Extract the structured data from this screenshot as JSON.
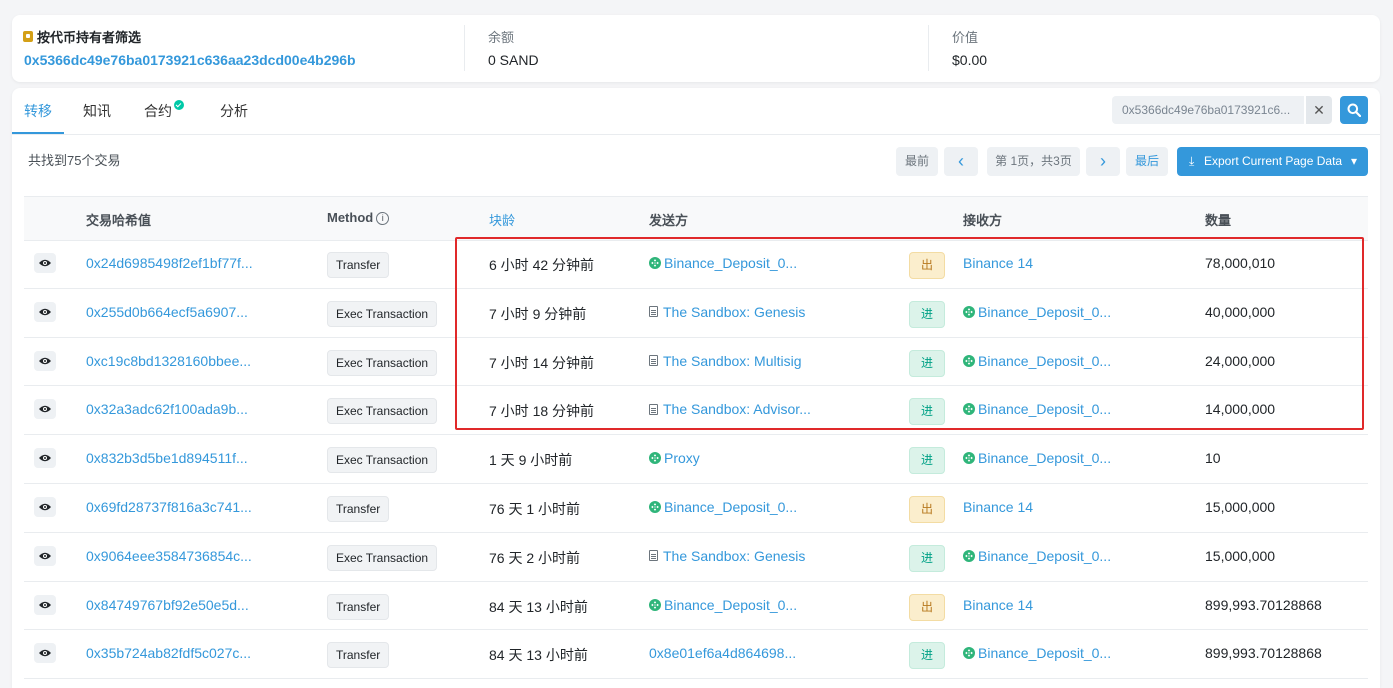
{
  "top": {
    "filter_label": "按代币持有者筛选",
    "address": "0x5366dc49e76ba0173921c636aa23dcd00e4b296b",
    "balance_label": "余额",
    "balance_value": "0 SAND",
    "value_label": "价值",
    "value_value": "$0.00"
  },
  "tabs": [
    "转移",
    "知讯",
    "合约",
    "分析"
  ],
  "filter": {
    "value": "0x5366dc49e76ba0173921c6..."
  },
  "found_text": "共找到75个交易",
  "pagination": {
    "first": "最前",
    "prev": "‹",
    "info": "第 1页，共3页",
    "next": "›",
    "last": "最后"
  },
  "export_label": "Export Current Page Data",
  "table": {
    "headers": {
      "hash": "交易哈希值",
      "method": "Method",
      "age": "块龄",
      "from": "发送方",
      "to": "接收方",
      "quantity": "数量"
    },
    "rows": [
      {
        "hash": "0x24d6985498f2ef1bf77f...",
        "method": "Transfer",
        "age": "6 小时 42 分钟前",
        "from": "Binance_Deposit_0...",
        "from_icon": "binance-icon",
        "dir": "出",
        "to": "Binance 14",
        "to_icon": "",
        "qty": "78,000,010"
      },
      {
        "hash": "0x255d0b664ecf5a6907...",
        "method": "Exec Transaction",
        "age": "7 小时 9 分钟前",
        "from": "The Sandbox: Genesis",
        "from_icon": "contract-icon",
        "dir": "进",
        "to": "Binance_Deposit_0...",
        "to_icon": "binance-icon",
        "qty": "40,000,000"
      },
      {
        "hash": "0xc19c8bd1328160bbee...",
        "method": "Exec Transaction",
        "age": "7 小时 14 分钟前",
        "from": "The Sandbox: Multisig",
        "from_icon": "contract-icon",
        "dir": "进",
        "to": "Binance_Deposit_0...",
        "to_icon": "binance-icon",
        "qty": "24,000,000"
      },
      {
        "hash": "0x32a3adc62f100ada9b...",
        "method": "Exec Transaction",
        "age": "7 小时 18 分钟前",
        "from": "The Sandbox: Advisor...",
        "from_icon": "contract-icon",
        "dir": "进",
        "to": "Binance_Deposit_0...",
        "to_icon": "binance-icon",
        "qty": "14,000,000"
      },
      {
        "hash": "0x832b3d5be1d894511f...",
        "method": "Exec Transaction",
        "age": "1 天 9 小时前",
        "from": "Proxy",
        "from_icon": "binance-icon",
        "dir": "进",
        "to": "Binance_Deposit_0...",
        "to_icon": "binance-icon",
        "qty": "10"
      },
      {
        "hash": "0x69fd28737f816a3c741...",
        "method": "Transfer",
        "age": "76 天 1 小时前",
        "from": "Binance_Deposit_0...",
        "from_icon": "binance-icon",
        "dir": "出",
        "to": "Binance 14",
        "to_icon": "",
        "qty": "15,000,000"
      },
      {
        "hash": "0x9064eee3584736854c...",
        "method": "Exec Transaction",
        "age": "76 天 2 小时前",
        "from": "The Sandbox: Genesis",
        "from_icon": "contract-icon",
        "dir": "进",
        "to": "Binance_Deposit_0...",
        "to_icon": "binance-icon",
        "qty": "15,000,000"
      },
      {
        "hash": "0x84749767bf92e50e5d...",
        "method": "Transfer",
        "age": "84 天 13 小时前",
        "from": "Binance_Deposit_0...",
        "from_icon": "binance-icon",
        "dir": "出",
        "to": "Binance 14",
        "to_icon": "",
        "qty": "899,993.70128868"
      },
      {
        "hash": "0x35b724ab82fdf5c027c...",
        "method": "Transfer",
        "age": "84 天 13 小时前",
        "from": "0x8e01ef6a4d864698...",
        "from_icon": "",
        "dir": "进",
        "to": "Binance_Deposit_0...",
        "to_icon": "binance-icon",
        "qty": "899,993.70128868"
      }
    ]
  }
}
